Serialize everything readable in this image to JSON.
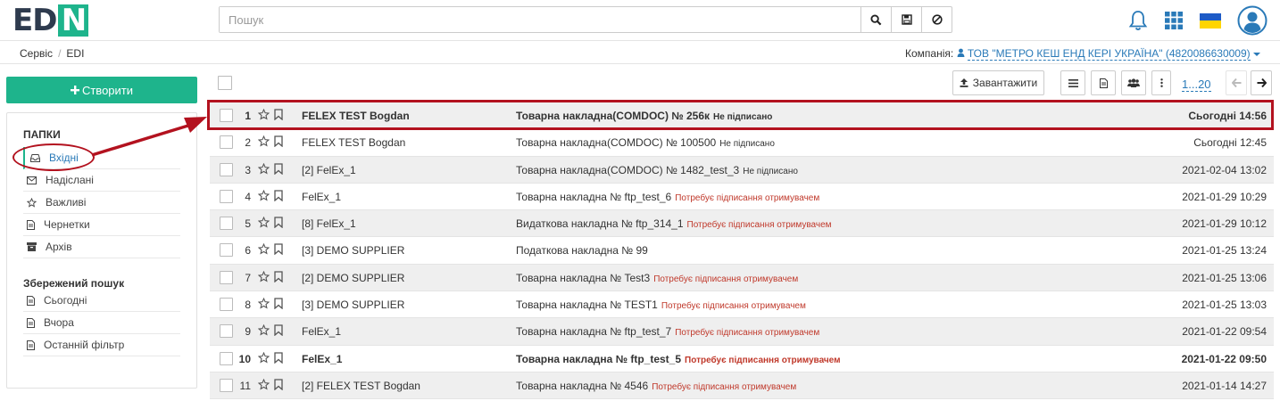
{
  "app": {
    "logo_main": "ED",
    "logo_accent": "N"
  },
  "search": {
    "placeholder": "Пошук"
  },
  "breadcrumb": {
    "root": "Сервіс",
    "sep": "/",
    "current": "EDI"
  },
  "company": {
    "label": "Компанія:",
    "name": "ТОВ \"МЕТРО КЕШ ЕНД КЕРІ УКРАЇНА\" (4820086630009)"
  },
  "create": {
    "label": "Створити"
  },
  "folders": {
    "title": "ПАПКИ",
    "items": [
      {
        "label": "Вхідні",
        "icon": "inbox-icon"
      },
      {
        "label": "Надіслані",
        "icon": "envelope-icon"
      },
      {
        "label": "Важливі",
        "icon": "star-icon"
      },
      {
        "label": "Чернетки",
        "icon": "file-icon"
      },
      {
        "label": "Архів",
        "icon": "archive-icon"
      }
    ]
  },
  "saved": {
    "title": "Збережений пошук",
    "items": [
      {
        "label": "Сьогодні",
        "icon": "file-icon"
      },
      {
        "label": "Вчора",
        "icon": "file-icon"
      },
      {
        "label": "Останній фільтр",
        "icon": "file-icon"
      }
    ]
  },
  "toolbar": {
    "upload_label": "Завантажити",
    "pager": "1...20"
  },
  "rows": [
    {
      "num": "1",
      "org": "FELEX TEST Bogdan",
      "doc": "Товарна накладна(COMDOC) № 256к",
      "status": "Не підписано",
      "date": "Сьогодні 14:56"
    },
    {
      "num": "2",
      "org": "FELEX TEST Bogdan",
      "doc": "Товарна накладна(COMDOC) № 100500",
      "status": "Не підписано",
      "date": "Сьогодні 12:45"
    },
    {
      "num": "3",
      "org": "[2] FelEx_1",
      "doc": "Товарна накладна(COMDOC) № 1482_test_3",
      "status": "Не підписано",
      "date": "2021-02-04 13:02"
    },
    {
      "num": "4",
      "org": "FelEx_1",
      "doc": "Товарна накладна № ftp_test_6",
      "status": "Потребує підписання отримувачем",
      "date": "2021-01-29 10:29"
    },
    {
      "num": "5",
      "org": "[8] FelEx_1",
      "doc": "Видаткова накладна № ftp_314_1",
      "status": "Потребує підписання отримувачем",
      "date": "2021-01-29 10:12"
    },
    {
      "num": "6",
      "org": "[3] DEMO SUPPLIER",
      "doc": "Податкова накладна № 99",
      "status": "",
      "date": "2021-01-25 13:24"
    },
    {
      "num": "7",
      "org": "[2] DEMO SUPPLIER",
      "doc": "Товарна накладна № Test3",
      "status": "Потребує підписання отримувачем",
      "date": "2021-01-25 13:06"
    },
    {
      "num": "8",
      "org": "[3] DEMO SUPPLIER",
      "doc": "Товарна накладна № TEST1",
      "status": "Потребує підписання отримувачем",
      "date": "2021-01-25 13:03"
    },
    {
      "num": "9",
      "org": "FelEx_1",
      "doc": "Товарна накладна № ftp_test_7",
      "status": "Потребує підписання отримувачем",
      "date": "2021-01-22 09:54"
    },
    {
      "num": "10",
      "org": "FelEx_1",
      "doc": "Товарна накладна № ftp_test_5",
      "status": "Потребує підписання отримувачем",
      "date": "2021-01-22 09:50"
    },
    {
      "num": "11",
      "org": "[2] FELEX TEST Bogdan",
      "doc": "Товарна накладна № 4546",
      "status": "Потребує підписання отримувачем",
      "date": "2021-01-14 14:27"
    }
  ],
  "colors": {
    "accent": "#1eb48c",
    "highlight": "#b3121f",
    "link": "#2a7ab8",
    "status_red": "#c0392b"
  }
}
